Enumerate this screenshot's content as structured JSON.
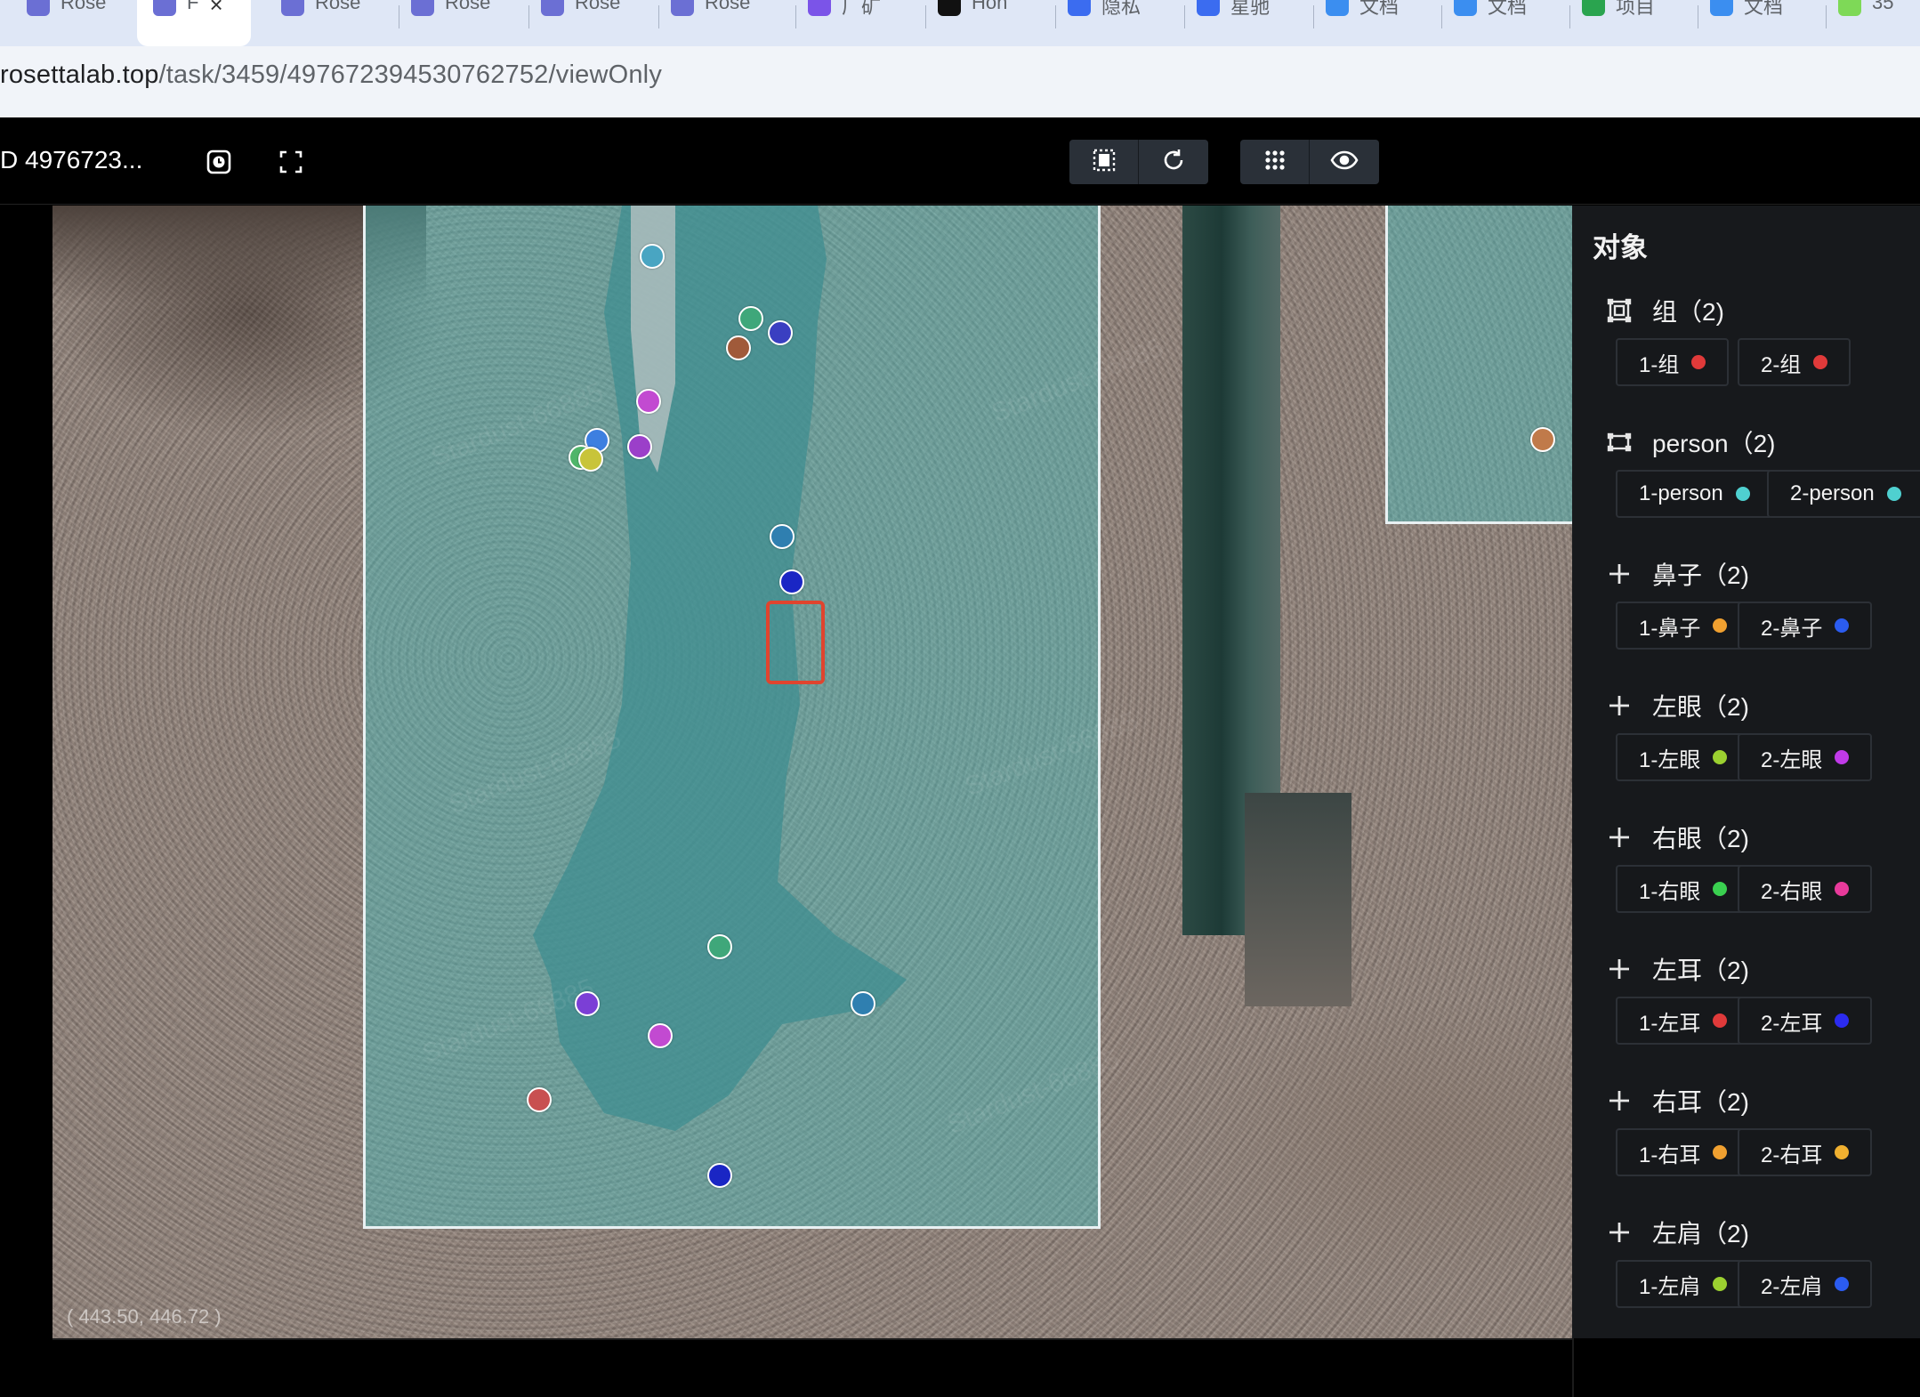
{
  "browser": {
    "tabs": [
      {
        "label": "Rose",
        "icon": "rosetta-icon",
        "color": "#6b6fd4"
      },
      {
        "label": "F",
        "icon": "rosetta-icon",
        "color": "#6b6fd4",
        "active": true
      },
      {
        "label": "Rose",
        "icon": "rosetta-icon",
        "color": "#6b6fd4"
      },
      {
        "label": "Rose",
        "icon": "rosetta-icon",
        "color": "#6b6fd4"
      },
      {
        "label": "Rose",
        "icon": "rosetta-icon",
        "color": "#6b6fd4"
      },
      {
        "label": "Rose",
        "icon": "rosetta-icon",
        "color": "#6b6fd4"
      },
      {
        "label": "厂矿",
        "icon": "s-app-icon",
        "color": "#7b54e8"
      },
      {
        "label": "Hon",
        "icon": "github-icon",
        "color": "#111111"
      },
      {
        "label": "隐私",
        "icon": "doc-icon",
        "color": "#3b6cf0"
      },
      {
        "label": "星驰",
        "icon": "doc-icon",
        "color": "#3b6cf0"
      },
      {
        "label": "文档",
        "icon": "cloud-doc-icon",
        "color": "#3b8ef0"
      },
      {
        "label": "文档",
        "icon": "cloud-doc-icon",
        "color": "#3b8ef0"
      },
      {
        "label": "项目",
        "icon": "sheet-icon",
        "color": "#2aa44f"
      },
      {
        "label": "文档",
        "icon": "cloud-doc-icon",
        "color": "#3b8ef0"
      },
      {
        "label": "35",
        "icon": "leaf-icon",
        "color": "#7ed957"
      }
    ],
    "url_host": "rosettalab.top",
    "url_path": "/task/3459/497672394530762752/viewOnly"
  },
  "toolbar": {
    "task_id": "D 4976723...",
    "icons": [
      "history-icon",
      "fullscreen-icon"
    ],
    "group1": [
      "select-frame-icon",
      "rotate-icon"
    ],
    "group2": [
      "grid-icon",
      "eye-icon"
    ]
  },
  "canvas": {
    "coordinate_readout": "( 443.50, 446.72 )",
    "watermark": "Stardust-66885",
    "keypoints": [
      {
        "color": "#49a5c2"
      },
      {
        "color": "#3fa77a"
      },
      {
        "color": "#3a3fc1"
      },
      {
        "color": "#a05a3a"
      },
      {
        "color": "#c24ad1"
      },
      {
        "color": "#3d7fe0"
      },
      {
        "color": "#9b3fc9"
      },
      {
        "color": "#4fb56a"
      },
      {
        "color": "#c8c43a"
      },
      {
        "color": "#2f7fb0"
      },
      {
        "color": "#1a26c4"
      },
      {
        "color": "#3fa77a"
      },
      {
        "color": "#7b3fd6"
      },
      {
        "color": "#c24ad1"
      },
      {
        "color": "#2f7fb0"
      },
      {
        "color": "#c85050"
      },
      {
        "color": "#1a26c4"
      },
      {
        "color": "#c07a4a"
      }
    ]
  },
  "panel": {
    "title": "对象",
    "groups": [
      {
        "icon": "group-icon",
        "label": "组（2)",
        "items": [
          {
            "label": "1-组",
            "color": "#e03a3a"
          },
          {
            "label": "2-组",
            "color": "#e03a3a"
          }
        ]
      },
      {
        "icon": "bbox-icon",
        "label": "person（2)",
        "items": [
          {
            "label": "1-person",
            "color": "#4fd0d0"
          },
          {
            "label": "2-person",
            "color": "#4fd0d0"
          }
        ]
      },
      {
        "icon": "plus-icon",
        "label": "鼻子（2)",
        "items": [
          {
            "label": "1-鼻子",
            "color": "#f0a030"
          },
          {
            "label": "2-鼻子",
            "color": "#2b5cf0"
          }
        ]
      },
      {
        "icon": "plus-icon",
        "label": "左眼（2)",
        "items": [
          {
            "label": "1-左眼",
            "color": "#9bd030"
          },
          {
            "label": "2-左眼",
            "color": "#c03ae8"
          }
        ]
      },
      {
        "icon": "plus-icon",
        "label": "右眼（2)",
        "items": [
          {
            "label": "1-右眼",
            "color": "#3ad050"
          },
          {
            "label": "2-右眼",
            "color": "#e83a9b"
          }
        ]
      },
      {
        "icon": "plus-icon",
        "label": "左耳（2)",
        "items": [
          {
            "label": "1-左耳",
            "color": "#e03a3a"
          },
          {
            "label": "2-左耳",
            "color": "#2b2bf0"
          }
        ]
      },
      {
        "icon": "plus-icon",
        "label": "右耳（2)",
        "items": [
          {
            "label": "1-右耳",
            "color": "#f0a030"
          },
          {
            "label": "2-右耳",
            "color": "#f0b030"
          }
        ]
      },
      {
        "icon": "plus-icon",
        "label": "左肩（2)",
        "items": [
          {
            "label": "1-左肩",
            "color": "#9bd030"
          },
          {
            "label": "2-左肩",
            "color": "#2b5cf0"
          }
        ]
      }
    ]
  }
}
